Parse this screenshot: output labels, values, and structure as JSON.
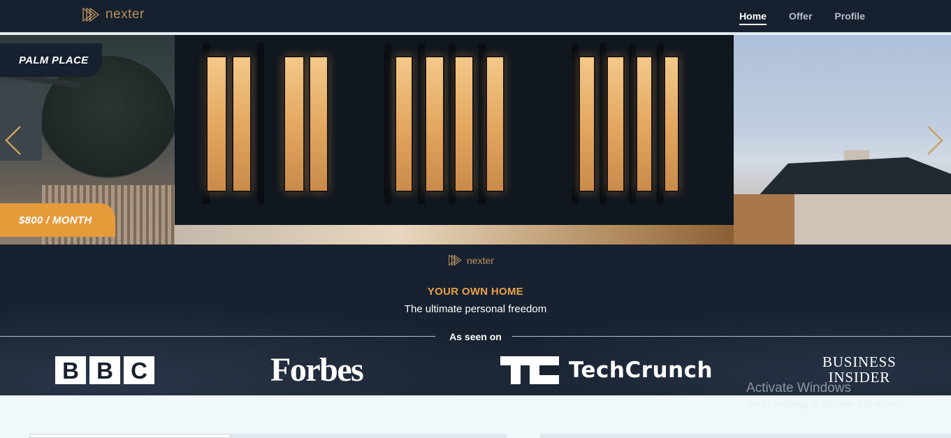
{
  "header": {
    "logo_text": "nexter",
    "nav": [
      {
        "label": "Home",
        "active": true
      },
      {
        "label": "Offer",
        "active": false
      },
      {
        "label": "Profile",
        "active": false
      }
    ]
  },
  "hero": {
    "property_name": "PALM PLACE",
    "price": "$800 / MONTH",
    "prev_icon": "chevron-left-icon",
    "next_icon": "chevron-right-icon"
  },
  "intro": {
    "logo_text": "nexter",
    "headline": "YOUR OWN HOME",
    "subline": "The ultimate personal freedom",
    "seen_on": "As seen on"
  },
  "press": {
    "bbc": [
      "B",
      "B",
      "C"
    ],
    "forbes": "Forbes",
    "techcrunch": "TechCrunch",
    "business_insider_line1": "BUSINESS",
    "business_insider_line2": "INSIDER"
  },
  "watermark": {
    "title": "Activate Windows",
    "subtitle": "Go to Settings to activate Windows."
  },
  "colors": {
    "navy": "#16202e",
    "gold": "#b6915e",
    "orange": "#e69a3a",
    "headline": "#e7a24c",
    "light_bg": "#f0f8fb"
  }
}
